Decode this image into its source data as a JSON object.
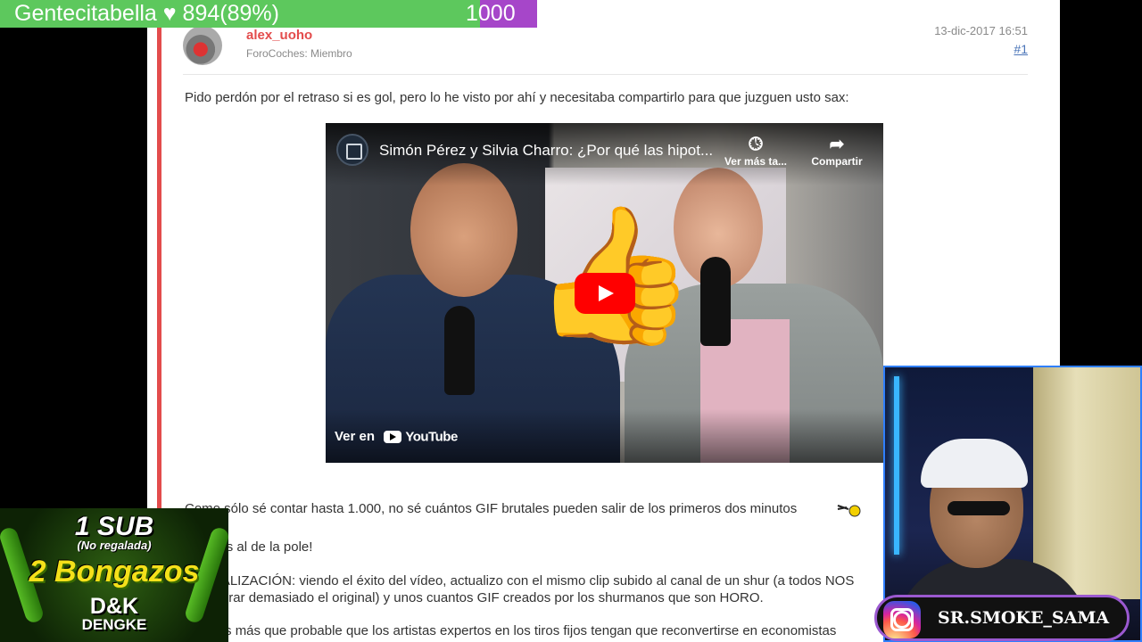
{
  "stream": {
    "goal_text": "Gentecitabella ♥ 894(89%)",
    "goal_max": "1000",
    "goal_progress": 0.894,
    "goal_colors": {
      "fill": "#5dc85d",
      "remainder": "#a646c9"
    },
    "promo": {
      "line1": "1 SUB",
      "line2": "(No regalada)",
      "line3": "2 Bongazos",
      "line4": "D&K",
      "line5": "DENGKE"
    },
    "instagram_handle": "SR.SMOKE_SAMA"
  },
  "post": {
    "username": "alex_uoho",
    "user_title": "ForoCoches: Miembro",
    "date": "13-dic-2017 16:51",
    "post_number": "#1",
    "intro": "Pido perdón por el retraso si es gol, pero lo he visto por ahí y necesitaba compartirlo para que juzguen usto sax:",
    "paragraphs": [
      "Como sólo sé contar hasta 1.000, no sé cuántos GIF brutales pueden salir de los primeros dos minutos",
      "Saludos al de la pole!",
      "ACTUALIZACIÓN: viendo el éxito del vídeo, actualizo con el mismo clip subido al canal de un shur (a todos NOS",
      "va a durar demasiado el original) y unos cuantos GIF creados por los shurmanos que son HORO.",
      "Creo es más que probable que los artistas expertos en los tiros fijos tengan que reconvertirse en economistas"
    ]
  },
  "video": {
    "title": "Simón Pérez y Silvia Charro: ¿Por qué las hipot...",
    "watch_later": "Ver más ta...",
    "share": "Compartir",
    "watch_on": "Ver en",
    "youtube": "YouTube"
  },
  "colors": {
    "accent_red": "#e34c4c",
    "link_blue": "#4a74b8",
    "play_red": "#ff0000",
    "webcam_border": "#2f7fff",
    "instagram_border": "#9b59d0"
  }
}
